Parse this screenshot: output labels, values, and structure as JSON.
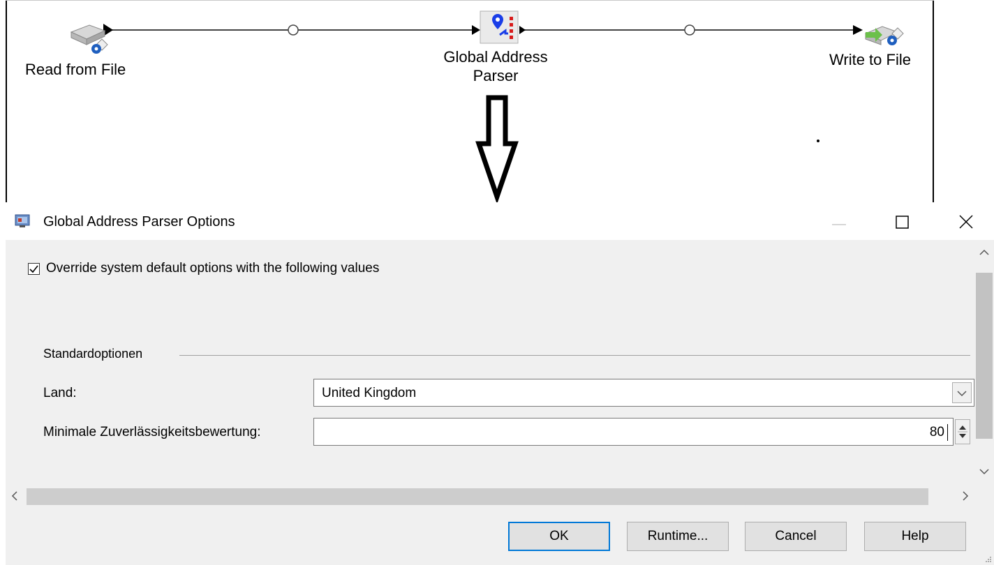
{
  "flow": {
    "read_stage_label": "Read from File",
    "parser_stage_label_line1": "Global Address",
    "parser_stage_label_line2": "Parser",
    "write_stage_label": "Write to File"
  },
  "dialog": {
    "title": "Global Address Parser Options",
    "override_checked": true,
    "override_label": "Override system default options with the following values",
    "group_title": "Standardoptionen",
    "land_label": "Land:",
    "land_value": "United Kingdom",
    "score_label": "Minimale Zuverlässigkeitsbewertung:",
    "score_value": "80",
    "buttons": {
      "ok": "OK",
      "runtime": "Runtime...",
      "cancel": "Cancel",
      "help": "Help"
    }
  },
  "icons": {
    "read": "file-reader-icon",
    "parser": "address-parser-icon",
    "write": "file-writer-icon",
    "app": "application-icon"
  },
  "colors": {
    "dialog_bg": "#f0f0f0",
    "accent": "#0078d7",
    "parser_pin": "#1a3ee8",
    "parser_bar": "#d81b1b"
  }
}
